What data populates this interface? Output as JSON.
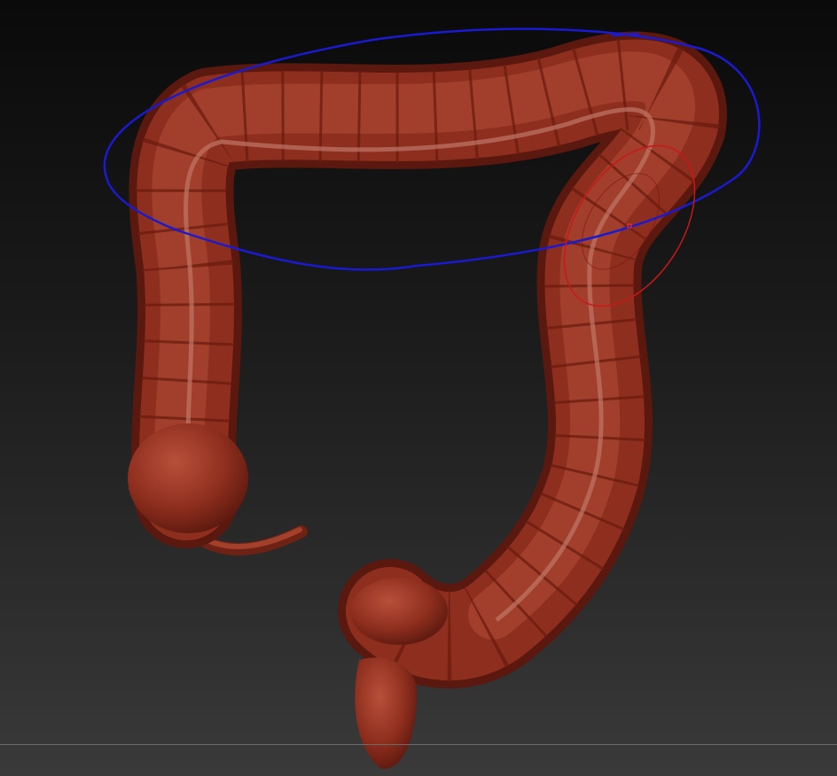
{
  "viewport": {
    "model": "colon-sculpt",
    "colors": {
      "model_base": "#8e2e1e",
      "model_highlight": "#b24a36",
      "model_shadow": "#5a180e",
      "groove": "#c07868",
      "selection_blue": "#1a1ad0",
      "brush_cursor_red": "#c81818"
    }
  }
}
